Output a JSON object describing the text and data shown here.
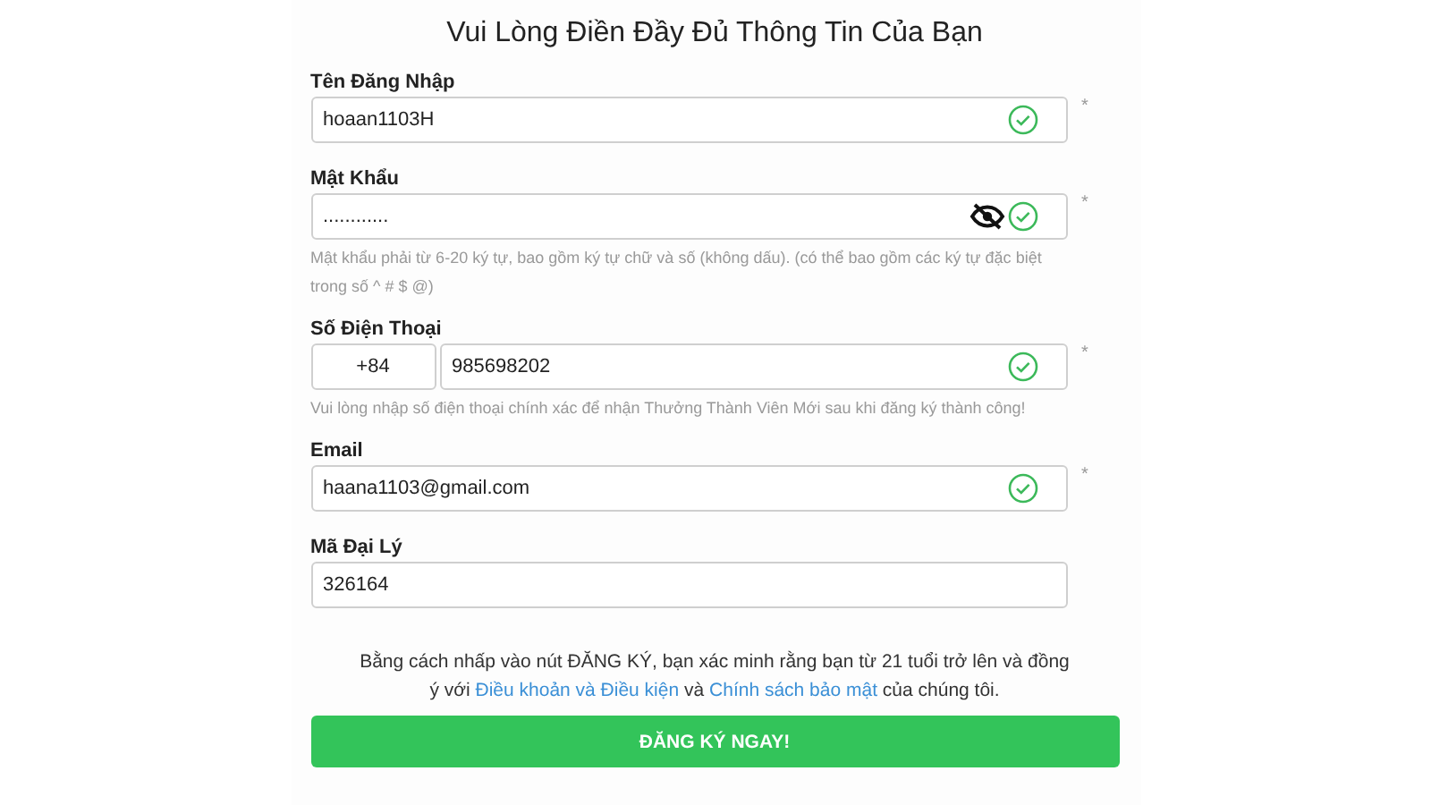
{
  "title": "Vui Lòng Điền Đầy Đủ Thông Tin Của Bạn",
  "fields": [
    {
      "kind": "text",
      "label": "Tên Đăng Nhập",
      "value": "hoaan1103H",
      "valid": true,
      "required_mark": "*"
    },
    {
      "kind": "password",
      "label": "Mật Khẩu",
      "value": "............",
      "valid": true,
      "required_mark": "*",
      "hint": "Mật khẩu phải từ 6-20 ký tự, bao gồm ký tự chữ và số (không dấu). (có thể bao gồm các ký tự đặc biệt trong số ^ # $ @)"
    },
    {
      "kind": "phone",
      "label": "Số Điện Thoại",
      "prefix": "+84",
      "value": "985698202",
      "valid": true,
      "required_mark": "*",
      "hint": "Vui lòng nhập số điện thoại chính xác để nhận Thưởng Thành Viên Mới sau khi đăng ký thành công!"
    },
    {
      "kind": "text",
      "label": "Email",
      "value": "haana1103@gmail.com",
      "valid": true,
      "required_mark": "*"
    },
    {
      "kind": "text",
      "label": "Mã Đại Lý",
      "value": "326164",
      "valid": false
    }
  ],
  "terms": {
    "before": "Bằng cách nhấp vào nút ĐĂNG KÝ, bạn xác minh rằng bạn từ 21 tuổi trở lên và đồng ý với",
    "link_1": "Điều khoản và Điều kiện",
    "middle": "và",
    "link_2": "Chính sách bảo mật",
    "after": "của chúng tôi."
  },
  "submit_button": "ĐĂNG KÝ NGAY!"
}
